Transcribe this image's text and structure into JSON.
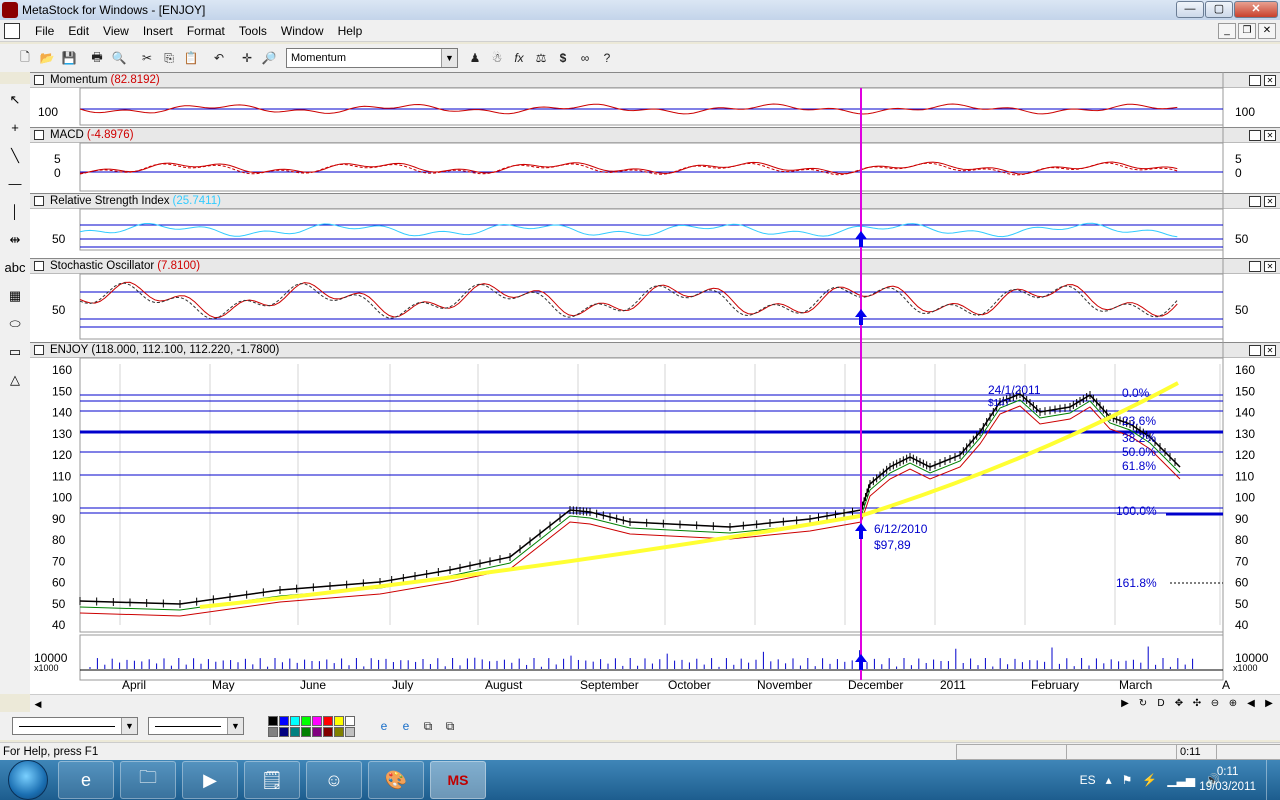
{
  "window": {
    "title": "MetaStock for Windows - [ENJOY]",
    "min": "—",
    "max": "▢",
    "close": "✕"
  },
  "menu": [
    "File",
    "Edit",
    "View",
    "Insert",
    "Format",
    "Tools",
    "Window",
    "Help"
  ],
  "mdi": {
    "min": "_",
    "restore": "❐",
    "close": "✕"
  },
  "toolbar": {
    "indicator_select": "Momentum",
    "icons": [
      "new-icon",
      "open-icon",
      "save-icon",
      "print-icon",
      "print-preview-icon",
      "cut-icon",
      "copy-icon",
      "paste-icon",
      "undo-icon",
      "crosshair-icon",
      "zoom-icon",
      "expert-icon",
      "explorer-icon",
      "formula-icon",
      "system-tester-icon",
      "dollar-icon",
      "binoculars-icon",
      "help-pointer-icon"
    ]
  },
  "panels": [
    {
      "name": "Momentum",
      "value": "(82.8192)",
      "value_color": "#d00000",
      "axis_labels": [
        "100"
      ]
    },
    {
      "name": "MACD",
      "value": "(-4.8976)",
      "value_color": "#d00000",
      "axis_labels": [
        "5",
        "0"
      ]
    },
    {
      "name": "Relative Strength Index",
      "value": "(25.7411)",
      "value_color": "#33ccff",
      "axis_labels": [
        "50"
      ]
    },
    {
      "name": "Stochastic Oscillator",
      "value": "(7.8100)",
      "value_color": "#d00000",
      "axis_labels": [
        "50"
      ]
    },
    {
      "name": "ENJOY",
      "value": "(118.000, 112.100, 112.220, -1.7800)",
      "value_color": "#000000",
      "axis_labels": [
        "160",
        "150",
        "140",
        "130",
        "120",
        "110",
        "100",
        "90",
        "80",
        "70",
        "60",
        "50",
        "40"
      ]
    }
  ],
  "price_chart": {
    "fib_labels": [
      "0.0%",
      "23.6%",
      "38.2%",
      "50.0%",
      "61.8%",
      "100.0%",
      "161.8%"
    ],
    "annotation_top": "24/1/2011",
    "annotation_top_val": "$147",
    "annotation_signal_date": "6/12/2010",
    "annotation_signal_price": "$97,89"
  },
  "volume": {
    "axis_label": "10000",
    "unit": "x1000"
  },
  "months": [
    "April",
    "May",
    "June",
    "July",
    "August",
    "September",
    "October",
    "November",
    "December",
    "2011",
    "February",
    "March",
    "A"
  ],
  "status": {
    "help": "For Help, press F1",
    "time": "0:11"
  },
  "taskbar": {
    "lang": "ES",
    "time": "0:11",
    "date": "19/03/2011"
  },
  "colors": {
    "signal_line": "#e000e0",
    "ma_yellow": "#ffff33",
    "price": "#000000",
    "bands": "#cc0000",
    "volume": "#0000cc"
  }
}
